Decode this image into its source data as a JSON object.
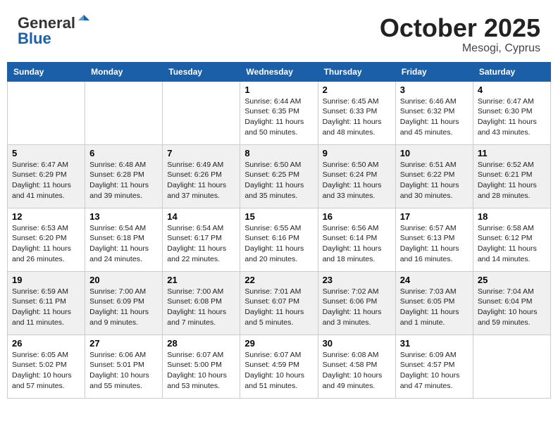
{
  "header": {
    "logo_line1": "General",
    "logo_line2": "Blue",
    "month": "October 2025",
    "location": "Mesogi, Cyprus"
  },
  "weekdays": [
    "Sunday",
    "Monday",
    "Tuesday",
    "Wednesday",
    "Thursday",
    "Friday",
    "Saturday"
  ],
  "weeks": [
    [
      {
        "day": "",
        "info": ""
      },
      {
        "day": "",
        "info": ""
      },
      {
        "day": "",
        "info": ""
      },
      {
        "day": "1",
        "info": "Sunrise: 6:44 AM\nSunset: 6:35 PM\nDaylight: 11 hours\nand 50 minutes."
      },
      {
        "day": "2",
        "info": "Sunrise: 6:45 AM\nSunset: 6:33 PM\nDaylight: 11 hours\nand 48 minutes."
      },
      {
        "day": "3",
        "info": "Sunrise: 6:46 AM\nSunset: 6:32 PM\nDaylight: 11 hours\nand 45 minutes."
      },
      {
        "day": "4",
        "info": "Sunrise: 6:47 AM\nSunset: 6:30 PM\nDaylight: 11 hours\nand 43 minutes."
      }
    ],
    [
      {
        "day": "5",
        "info": "Sunrise: 6:47 AM\nSunset: 6:29 PM\nDaylight: 11 hours\nand 41 minutes."
      },
      {
        "day": "6",
        "info": "Sunrise: 6:48 AM\nSunset: 6:28 PM\nDaylight: 11 hours\nand 39 minutes."
      },
      {
        "day": "7",
        "info": "Sunrise: 6:49 AM\nSunset: 6:26 PM\nDaylight: 11 hours\nand 37 minutes."
      },
      {
        "day": "8",
        "info": "Sunrise: 6:50 AM\nSunset: 6:25 PM\nDaylight: 11 hours\nand 35 minutes."
      },
      {
        "day": "9",
        "info": "Sunrise: 6:50 AM\nSunset: 6:24 PM\nDaylight: 11 hours\nand 33 minutes."
      },
      {
        "day": "10",
        "info": "Sunrise: 6:51 AM\nSunset: 6:22 PM\nDaylight: 11 hours\nand 30 minutes."
      },
      {
        "day": "11",
        "info": "Sunrise: 6:52 AM\nSunset: 6:21 PM\nDaylight: 11 hours\nand 28 minutes."
      }
    ],
    [
      {
        "day": "12",
        "info": "Sunrise: 6:53 AM\nSunset: 6:20 PM\nDaylight: 11 hours\nand 26 minutes."
      },
      {
        "day": "13",
        "info": "Sunrise: 6:54 AM\nSunset: 6:18 PM\nDaylight: 11 hours\nand 24 minutes."
      },
      {
        "day": "14",
        "info": "Sunrise: 6:54 AM\nSunset: 6:17 PM\nDaylight: 11 hours\nand 22 minutes."
      },
      {
        "day": "15",
        "info": "Sunrise: 6:55 AM\nSunset: 6:16 PM\nDaylight: 11 hours\nand 20 minutes."
      },
      {
        "day": "16",
        "info": "Sunrise: 6:56 AM\nSunset: 6:14 PM\nDaylight: 11 hours\nand 18 minutes."
      },
      {
        "day": "17",
        "info": "Sunrise: 6:57 AM\nSunset: 6:13 PM\nDaylight: 11 hours\nand 16 minutes."
      },
      {
        "day": "18",
        "info": "Sunrise: 6:58 AM\nSunset: 6:12 PM\nDaylight: 11 hours\nand 14 minutes."
      }
    ],
    [
      {
        "day": "19",
        "info": "Sunrise: 6:59 AM\nSunset: 6:11 PM\nDaylight: 11 hours\nand 11 minutes."
      },
      {
        "day": "20",
        "info": "Sunrise: 7:00 AM\nSunset: 6:09 PM\nDaylight: 11 hours\nand 9 minutes."
      },
      {
        "day": "21",
        "info": "Sunrise: 7:00 AM\nSunset: 6:08 PM\nDaylight: 11 hours\nand 7 minutes."
      },
      {
        "day": "22",
        "info": "Sunrise: 7:01 AM\nSunset: 6:07 PM\nDaylight: 11 hours\nand 5 minutes."
      },
      {
        "day": "23",
        "info": "Sunrise: 7:02 AM\nSunset: 6:06 PM\nDaylight: 11 hours\nand 3 minutes."
      },
      {
        "day": "24",
        "info": "Sunrise: 7:03 AM\nSunset: 6:05 PM\nDaylight: 11 hours\nand 1 minute."
      },
      {
        "day": "25",
        "info": "Sunrise: 7:04 AM\nSunset: 6:04 PM\nDaylight: 10 hours\nand 59 minutes."
      }
    ],
    [
      {
        "day": "26",
        "info": "Sunrise: 6:05 AM\nSunset: 5:02 PM\nDaylight: 10 hours\nand 57 minutes."
      },
      {
        "day": "27",
        "info": "Sunrise: 6:06 AM\nSunset: 5:01 PM\nDaylight: 10 hours\nand 55 minutes."
      },
      {
        "day": "28",
        "info": "Sunrise: 6:07 AM\nSunset: 5:00 PM\nDaylight: 10 hours\nand 53 minutes."
      },
      {
        "day": "29",
        "info": "Sunrise: 6:07 AM\nSunset: 4:59 PM\nDaylight: 10 hours\nand 51 minutes."
      },
      {
        "day": "30",
        "info": "Sunrise: 6:08 AM\nSunset: 4:58 PM\nDaylight: 10 hours\nand 49 minutes."
      },
      {
        "day": "31",
        "info": "Sunrise: 6:09 AM\nSunset: 4:57 PM\nDaylight: 10 hours\nand 47 minutes."
      },
      {
        "day": "",
        "info": ""
      }
    ]
  ]
}
